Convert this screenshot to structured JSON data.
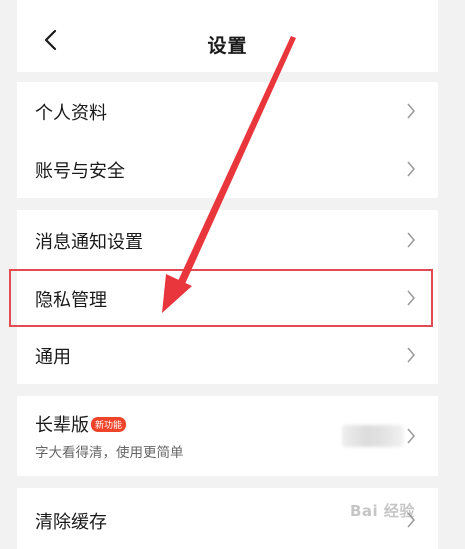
{
  "header": {
    "title": "设置",
    "back_icon": "chevron-left-icon"
  },
  "groups": [
    {
      "items": [
        {
          "label": "个人资料"
        },
        {
          "label": "账号与安全"
        }
      ]
    },
    {
      "items": [
        {
          "label": "消息通知设置"
        },
        {
          "label": "隐私管理"
        },
        {
          "label": "通用"
        }
      ]
    },
    {
      "items": [
        {
          "label": "长辈版",
          "badge": "新功能",
          "subtitle": "字大看得清，使用更简单"
        }
      ]
    },
    {
      "items": [
        {
          "label": "清除缓存"
        }
      ]
    }
  ],
  "annotation": {
    "highlight_color": "#e24b52",
    "arrow_color": "#e8363c"
  },
  "watermark": "Bai 经验"
}
